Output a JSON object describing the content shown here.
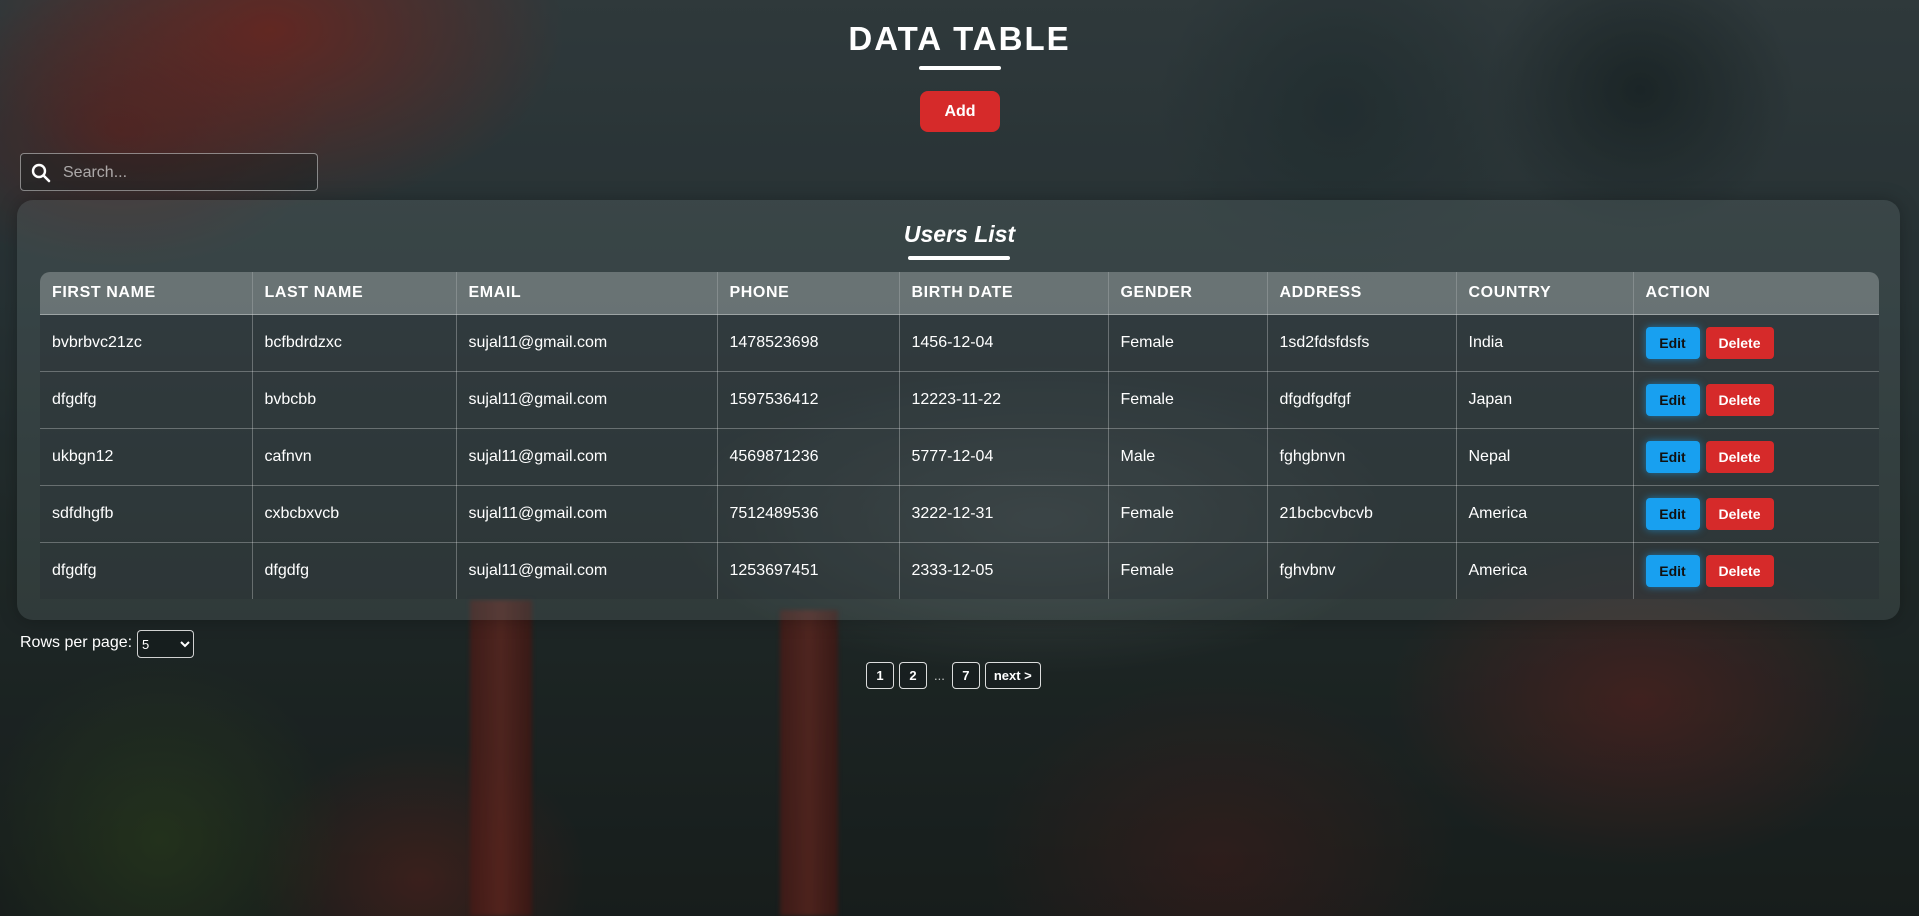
{
  "header": {
    "title": "DATA TABLE",
    "add_label": "Add"
  },
  "search": {
    "placeholder": "Search...",
    "value": ""
  },
  "list": {
    "title": "Users List"
  },
  "table": {
    "columns": [
      "FIRST NAME",
      "LAST NAME",
      "EMAIL",
      "PHONE",
      "BIRTH DATE",
      "GENDER",
      "ADDRESS",
      "COUNTRY",
      "ACTION"
    ],
    "rows": [
      [
        "bvbrbvc21zc",
        "bcfbdrdzxc",
        "sujal11@gmail.com",
        "1478523698",
        "1456-12-04",
        "Female",
        "1sd2fdsfdsfs",
        "India"
      ],
      [
        "dfgdfg",
        "bvbcbb",
        "sujal11@gmail.com",
        "1597536412",
        "12223-11-22",
        "Female",
        "dfgdfgdfgf",
        "Japan"
      ],
      [
        "ukbgn12",
        "cafnvn",
        "sujal11@gmail.com",
        "4569871236",
        "5777-12-04",
        "Male",
        "fghgbnvn",
        "Nepal"
      ],
      [
        "sdfdhgfb",
        "cxbcbxvcb",
        "sujal11@gmail.com",
        "7512489536",
        "3222-12-31",
        "Female",
        "21bcbcvbcvb",
        "America"
      ],
      [
        "dfgdfg",
        "dfgdfg",
        "sujal11@gmail.com",
        "1253697451",
        "2333-12-05",
        "Female",
        "fghvbnv",
        "America"
      ]
    ],
    "edit_label": "Edit",
    "delete_label": "Delete"
  },
  "footer": {
    "rows_per_page_label": "Rows per page:",
    "rows_per_page_value": "5"
  },
  "pagination": {
    "pages": [
      "1",
      "2",
      "7"
    ],
    "ellipsis": "...",
    "next_label": "next >"
  },
  "colors": {
    "add_button": "#d62a2a",
    "edit_button": "#18a0f0",
    "delete_button": "#d62a2a"
  },
  "icons": {
    "search": "search-icon",
    "select_arrow": "chevron-down-icon"
  }
}
